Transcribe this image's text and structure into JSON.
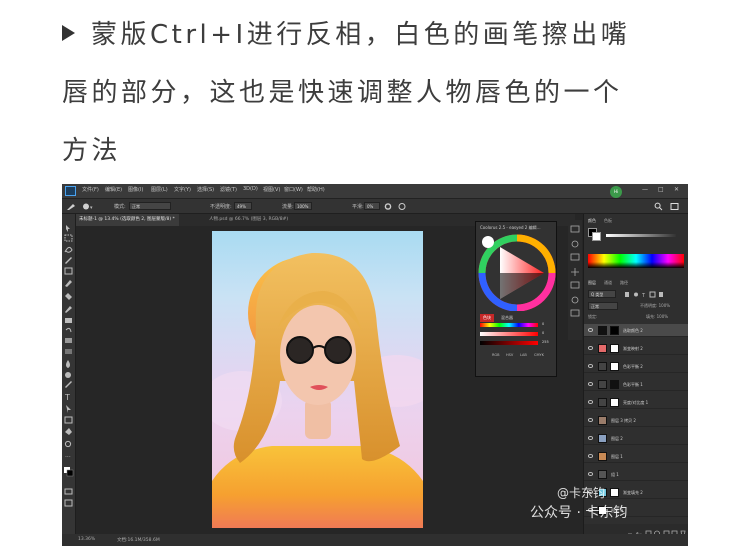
{
  "caption": {
    "lines": [
      "蒙版Ctrl+I进行反相，白色的画笔擦出嘴",
      "唇的部分，这也是快速调整人物唇色的一个",
      "方法"
    ]
  },
  "photoshop": {
    "menu": [
      "文件(F)",
      "编辑(E)",
      "图像(I)",
      "图层(L)",
      "文字(Y)",
      "选择(S)",
      "滤镜(T)",
      "3D(D)",
      "视图(V)",
      "窗口(W)",
      "帮助(H)"
    ],
    "avatar": "Hi",
    "options": {
      "mode_label": "模式:",
      "mode_value": "正常",
      "opacity_label": "不透明度:",
      "opacity_value": "49%",
      "flow_label": "流量:",
      "flow_value": "100%",
      "smooth_label": "平滑:",
      "smooth_value": "0%"
    },
    "tabs": [
      "未标题-1 @ 13.4% (选取颜色 2, 图层蒙版/8) *",
      "人物.psd @ 66.7% (图层 3, RGB/8#)"
    ],
    "color_panel": {
      "title": "Coolorus 2.5 - easyed 2 编辑…",
      "tabs": [
        "色块",
        "混合器"
      ],
      "fields": [
        "RGB",
        "HSV",
        "LAB",
        "CMYK"
      ],
      "values": [
        "0",
        "0",
        "255"
      ]
    },
    "right_panel": {
      "top_tabs": [
        "颜色",
        "色板"
      ],
      "layer_tabs": [
        "图层",
        "通道",
        "路径"
      ],
      "kind_label": "Q 类型",
      "blend": "正常",
      "opacity": "不透明度: 100%",
      "lock": "锁定:",
      "fill": "填充: 100%",
      "layers": [
        {
          "name": "选取颜色 2",
          "thumb": "#111",
          "mask": "#000",
          "selected": true
        },
        {
          "name": "渐变映射 2",
          "thumb": "#e46a6a",
          "mask": "#fff",
          "selected": false
        },
        {
          "name": "色彩平衡 2",
          "thumb": "#444",
          "mask": "#fff",
          "selected": false
        },
        {
          "name": "色彩平衡 1",
          "thumb": "#444",
          "mask": "#111",
          "selected": false
        },
        {
          "name": "亮度/对比度 1",
          "thumb": "#444",
          "mask": "#fff",
          "selected": false
        },
        {
          "name": "图层 3 拷贝 2",
          "thumb": "#9a7c6a",
          "mask": "",
          "selected": false
        },
        {
          "name": "图层 2",
          "thumb": "#8aa0c0",
          "mask": "",
          "selected": false
        },
        {
          "name": "图层 1",
          "thumb": "#c88a55",
          "mask": "",
          "selected": false
        },
        {
          "name": "组 1",
          "thumb": "#555",
          "mask": "",
          "selected": false
        },
        {
          "name": "渐变填充 2",
          "thumb": "#70c8e0",
          "mask": "#fff",
          "selected": false
        },
        {
          "name": "图层 0",
          "thumb": "#fff",
          "mask": "",
          "selected": false
        }
      ]
    },
    "status": [
      "13.36%",
      "文档:16.1M/358.6M"
    ]
  },
  "watermark": {
    "line1": "@卡东钧",
    "line2": "公众号 · 卡东钧"
  },
  "colors": {
    "ps_bg": "#262626",
    "panel": "#323232",
    "sun": "#f5a23c",
    "hair": "#e8a43d",
    "shirt": "#f6a930"
  }
}
